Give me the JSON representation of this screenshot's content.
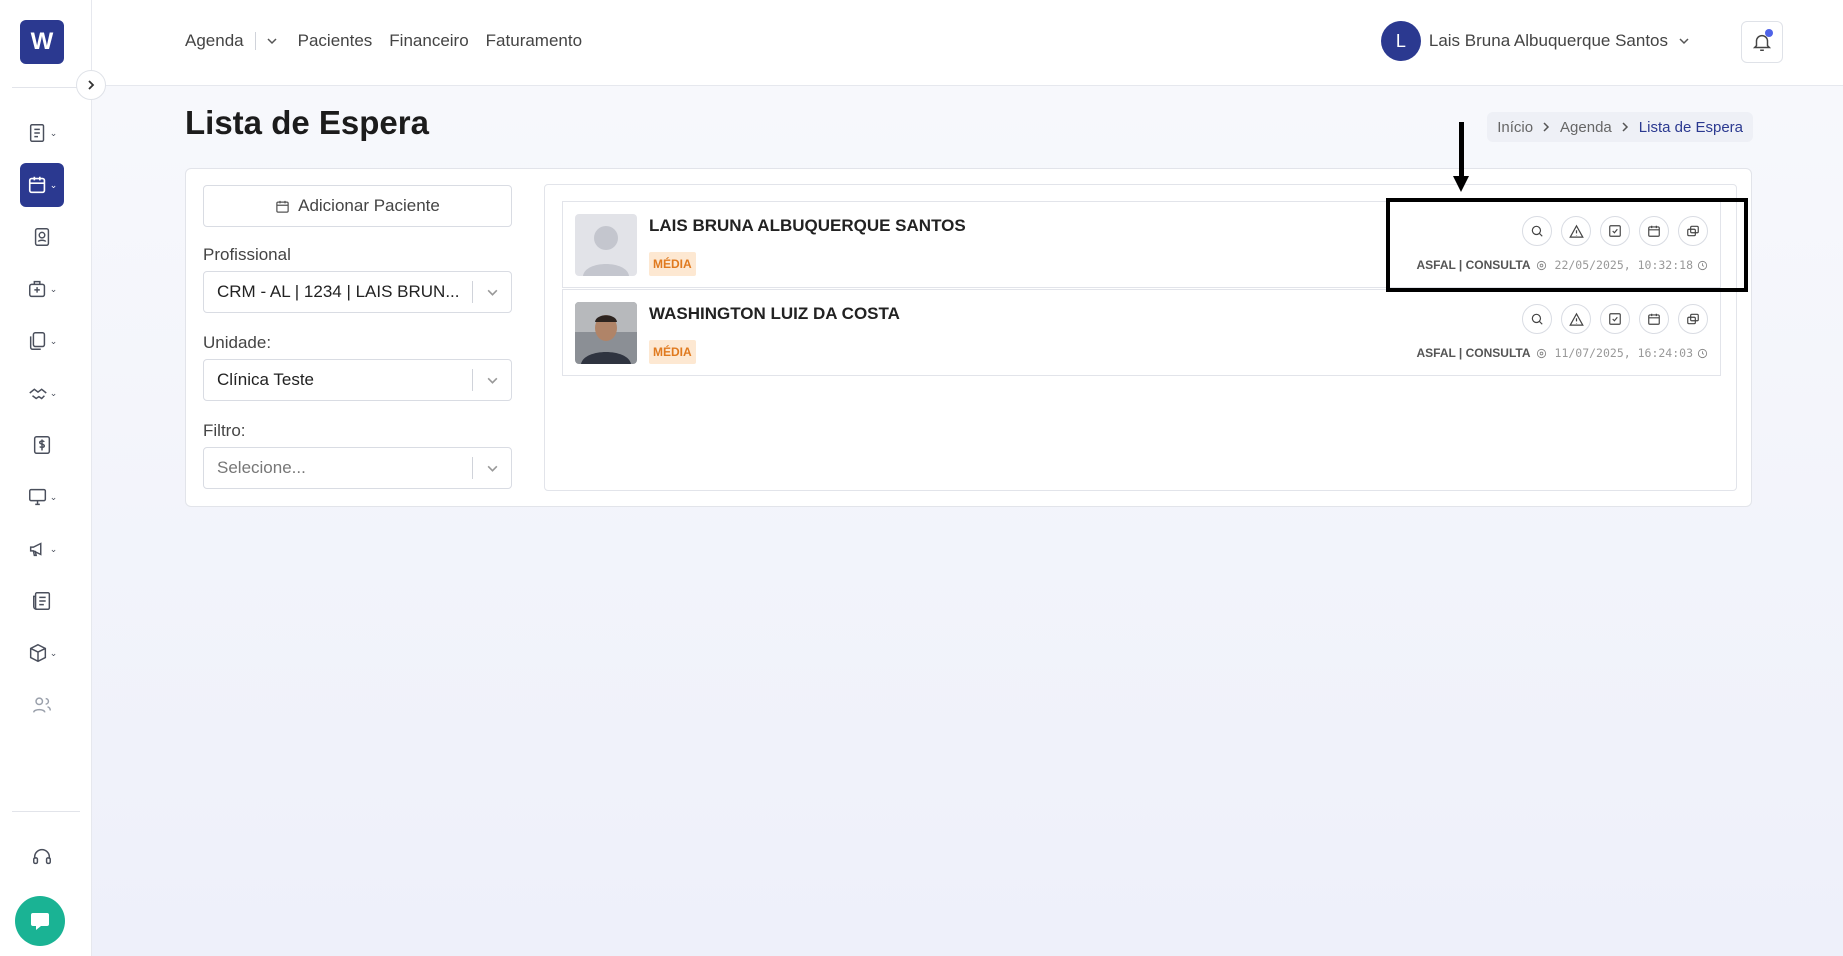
{
  "app": {
    "logo_letter": "W",
    "brand_color": "#2b3990"
  },
  "sidebar": {
    "icons": [
      {
        "name": "list-doc-icon",
        "has_caret": true
      },
      {
        "name": "calendar-icon",
        "has_caret": true,
        "active": true
      },
      {
        "name": "contact-card-icon",
        "has_caret": false
      },
      {
        "name": "medical-kit-icon",
        "has_caret": true
      },
      {
        "name": "documents-icon",
        "has_caret": true
      },
      {
        "name": "handshake-icon",
        "has_caret": true
      },
      {
        "name": "dollar-icon",
        "has_caret": false
      },
      {
        "name": "monitor-icon",
        "has_caret": true
      },
      {
        "name": "megaphone-icon",
        "has_caret": true
      },
      {
        "name": "newspaper-icon",
        "has_caret": false
      },
      {
        "name": "package-icon",
        "has_caret": true
      },
      {
        "name": "users-icon",
        "has_caret": false
      },
      {
        "name": "headset-icon",
        "has_caret": false
      }
    ]
  },
  "topnav": {
    "agenda": "Agenda",
    "pacientes": "Pacientes",
    "financeiro": "Financeiro",
    "faturamento": "Faturamento"
  },
  "user": {
    "initial": "L",
    "name": "Lais Bruna Albuquerque Santos"
  },
  "page": {
    "title": "Lista de Espera"
  },
  "breadcrumb": {
    "home": "Início",
    "parent": "Agenda",
    "current": "Lista de Espera"
  },
  "filters": {
    "add_button": "Adicionar Paciente",
    "profissional_label": "Profissional",
    "profissional_value": "CRM - AL | 1234 | LAIS BRUN...",
    "unidade_label": "Unidade:",
    "unidade_value": "Clínica Teste",
    "filtro_label": "Filtro:",
    "filtro_placeholder": "Selecione..."
  },
  "patients": [
    {
      "name": "LAIS BRUNA ALBUQUERQUE SANTOS",
      "priority": "MÉDIA",
      "type": "ASFAL | CONSULTA",
      "timestamp": "22/05/2025, 10:32:18"
    },
    {
      "name": "WASHINGTON LUIZ DA COSTA",
      "priority": "MÉDIA",
      "type": "ASFAL | CONSULTA",
      "timestamp": "11/07/2025, 16:24:03"
    }
  ]
}
